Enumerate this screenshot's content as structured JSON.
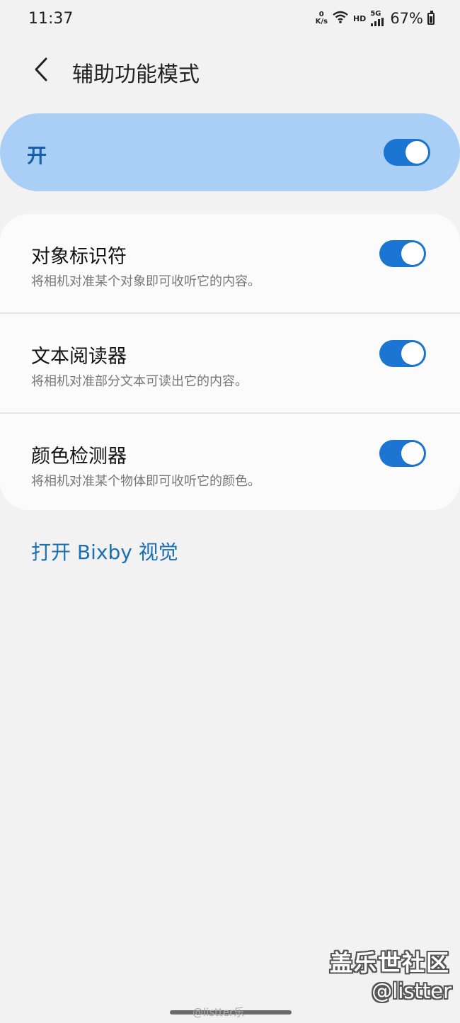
{
  "status_bar": {
    "time": "11:37",
    "net_speed_value": "0",
    "net_speed_unit": "K/s",
    "hd_label": "HD",
    "network_label": "5G",
    "battery_text": "67%",
    "battery_level": 0.67
  },
  "header": {
    "title": "辅助功能模式",
    "back_icon": "chevron-left-icon"
  },
  "master_switch": {
    "label": "开",
    "enabled": true,
    "accent_color": "#a9cff7"
  },
  "features": [
    {
      "title": "对象标识符",
      "description": "将相机对准某个对象即可收听它的内容。",
      "enabled": true
    },
    {
      "title": "文本阅读器",
      "description": "将相机对准部分文本可读出它的内容。",
      "enabled": true
    },
    {
      "title": "颜色检测器",
      "description": "将相机对准某个物体即可收听它的颜色。",
      "enabled": true
    }
  ],
  "bixby_link": "打开 Bixby 视觉",
  "watermark": {
    "brand": "盖乐世社区",
    "handle": "@listter",
    "weibo": "@listter乐"
  },
  "colors": {
    "toggle_on": "#1a76d2",
    "link": "#1a6fb5",
    "background": "#f2f2f2"
  }
}
